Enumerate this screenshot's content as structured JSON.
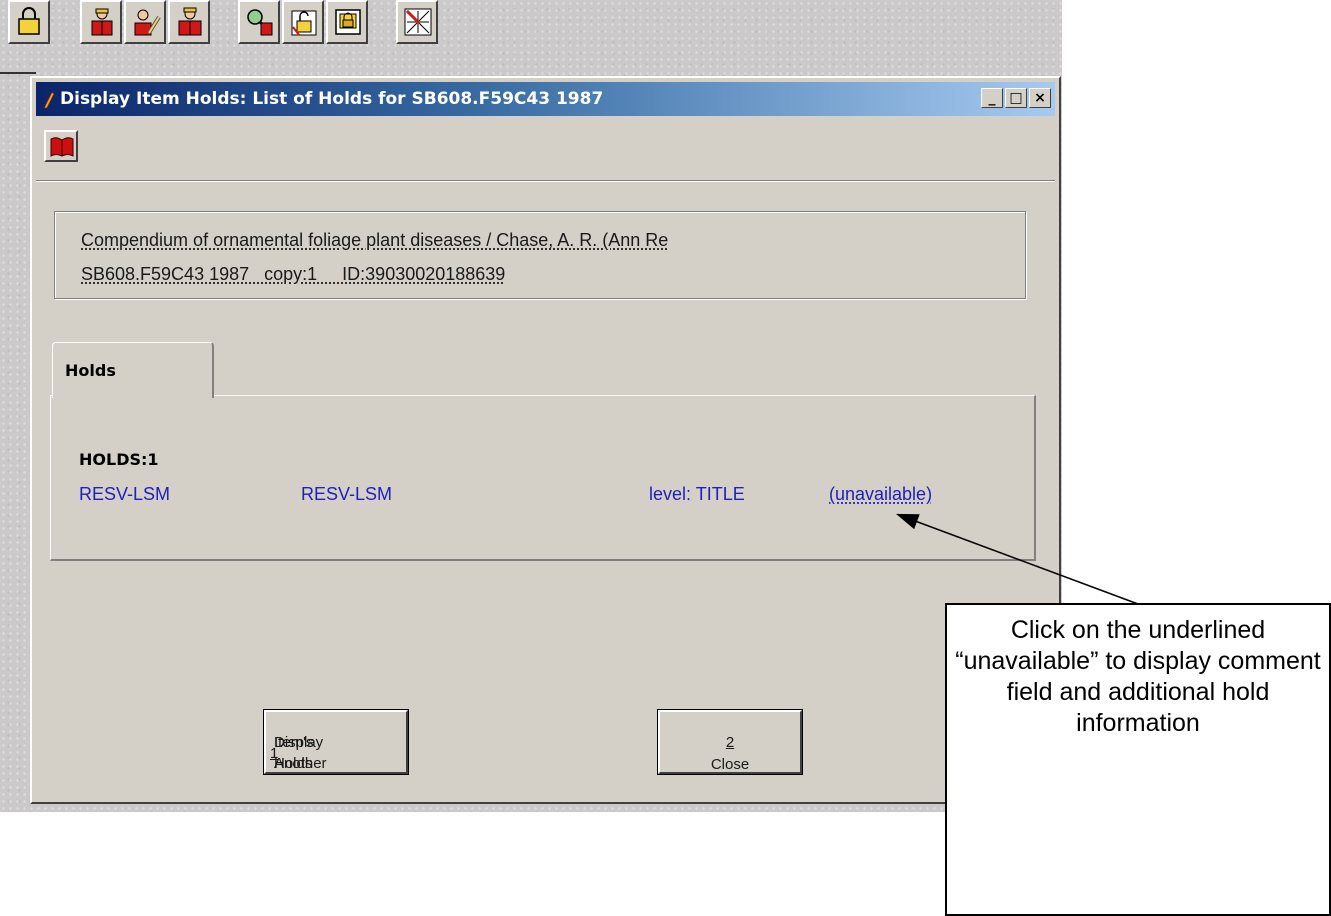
{
  "toolbar": {
    "buttons": [
      {
        "icon": "padlock-icon"
      },
      {
        "icon": "person-book-icon"
      },
      {
        "icon": "person-pencil-icon"
      },
      {
        "icon": "person-books-icon"
      },
      {
        "icon": "search-person-icon"
      },
      {
        "icon": "open-padlock-icon"
      },
      {
        "icon": "register-lock-icon"
      },
      {
        "icon": "net-tool-icon"
      }
    ]
  },
  "window": {
    "title": "Display Item Holds: List of Holds for SB608.F59C43 1987",
    "controls": {
      "minimize": "_",
      "maximize": "□",
      "close": "×"
    },
    "book_button_icon": "red-book-icon"
  },
  "item_info": {
    "title_line": "Compendium of ornamental foliage plant diseases / Chase, A. R. (Ann Re",
    "call_line": "SB608.F59C43 1987   copy:1     ID:39030020188639"
  },
  "tabs": {
    "active_label": "Holds"
  },
  "holds": {
    "count_label": "HOLDS:1",
    "row": {
      "field1": "RESV-LSM",
      "field2": "RESV-LSM",
      "level": "level: TITLE",
      "status_link": "(unavailable)"
    }
  },
  "buttons": {
    "display_another_line1": "Display Another",
    "display_another_line2": "Item's Holds ",
    "display_another_hotkey": "1",
    "close_label": "Close ",
    "close_hotkey": "2"
  },
  "callout": {
    "text": "Click on the underlined “unavailable” to display comment field and additional hold information"
  },
  "colors": {
    "title_gradient_start": "#0a246a",
    "link_blue": "#2020c0",
    "window_face": "#d4d0c8"
  }
}
